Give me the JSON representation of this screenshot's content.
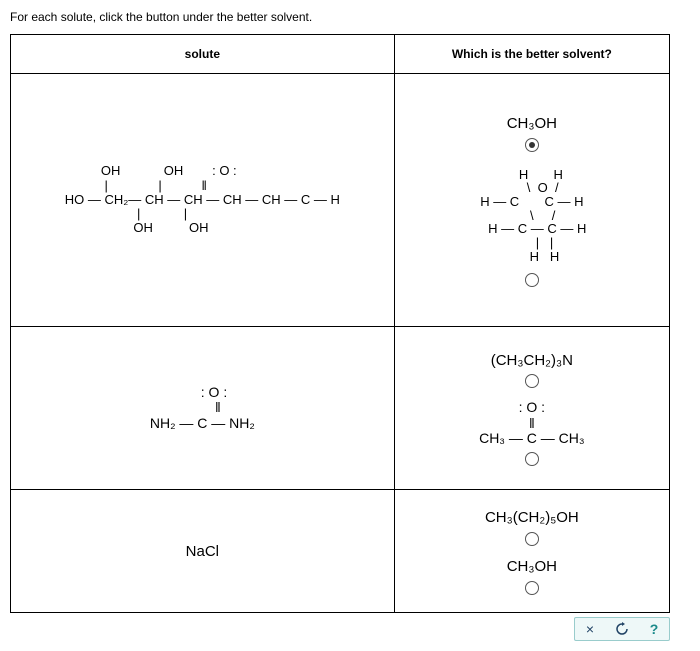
{
  "instruction": "For each solute, click the button under the better solvent.",
  "headers": {
    "solute": "solute",
    "solvent": "Which is the better solvent?"
  },
  "row1": {
    "solvent1": "CH₃OH",
    "solvent1_selected": true,
    "furan_label": "furan-structure",
    "solvent2_selected": false
  },
  "row2": {
    "solute_name": "urea",
    "solvent1": "(CH₃CH₂)₃N",
    "solvent1_selected": false,
    "acetone_top": ": O :",
    "acetone_mid": "‖",
    "acetone_line": "CH₃ — C — CH₃",
    "solvent2_selected": false
  },
  "row3": {
    "solute": "NaCl",
    "solvent1": "CH₃(CH₂)₅OH",
    "solvent1_selected": false,
    "solvent2": "CH₃OH",
    "solvent2_selected": false
  },
  "buttons": {
    "close": "×",
    "reset": "↻",
    "help": "?"
  }
}
